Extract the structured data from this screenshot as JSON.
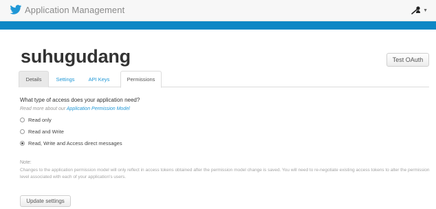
{
  "header": {
    "title": "Application Management",
    "logo_icon": "twitter-bird-icon",
    "user_menu_icon": "user-icon"
  },
  "colors": {
    "accent": "#0d87c5",
    "link": "#1f97d6"
  },
  "app": {
    "name": "suhugudang",
    "test_oauth_label": "Test OAuth"
  },
  "tabs": [
    {
      "label": "Details",
      "active": false
    },
    {
      "label": "Settings",
      "active": false
    },
    {
      "label": "API Keys",
      "active": false
    },
    {
      "label": "Permissions",
      "active": true
    }
  ],
  "permissions": {
    "question": "What type of access does your application need?",
    "read_more_prefix": "Read more about our",
    "read_more_link": "Application Permission Model",
    "options": [
      {
        "label": "Read only",
        "selected": false
      },
      {
        "label": "Read and Write",
        "selected": false
      },
      {
        "label": "Read, Write and Access direct messages",
        "selected": true
      }
    ],
    "note_label": "Note:",
    "note_text": "Changes to the application permission model will only reflect in access tokens obtained after the permission model change is saved. You will need to re-negotiate existing access tokens to alter the permission level associated with each of your application's users.",
    "update_label": "Update settings"
  }
}
